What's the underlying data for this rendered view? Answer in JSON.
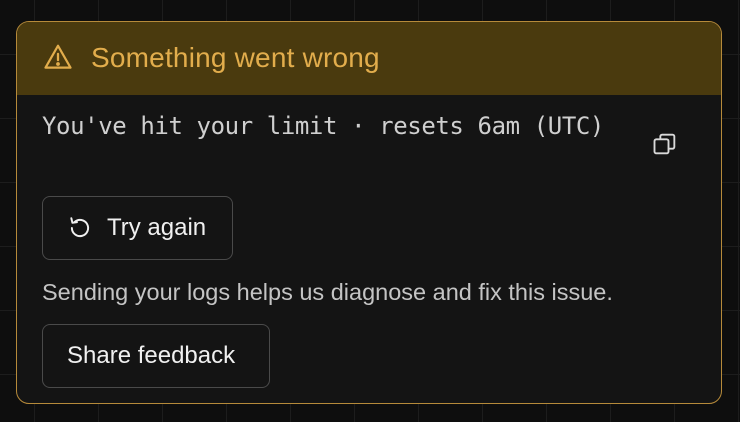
{
  "error_card": {
    "title": "Something went wrong",
    "message": "You've hit your limit · resets 6am (UTC)",
    "retry_label": "Try again",
    "hint": "Sending your logs helps us diagnose and fix this issue.",
    "feedback_label": "Share feedback"
  },
  "icons": {
    "header": "warning-triangle-icon",
    "copy": "copy-icon",
    "retry": "refresh-icon"
  },
  "colors": {
    "accent": "#e2ad4c",
    "header_bg": "#4a3a0e",
    "border": "#b68a3a",
    "card_bg": "#141414"
  }
}
